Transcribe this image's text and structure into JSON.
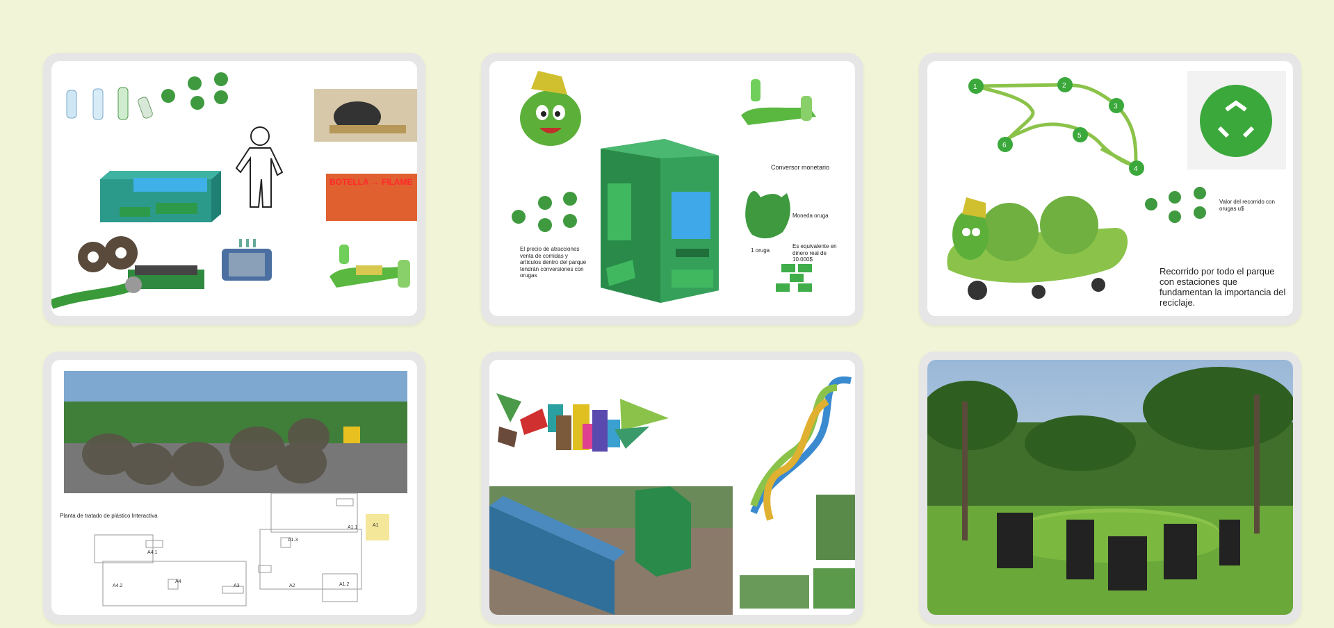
{
  "gallery": {
    "background": "#f2f4d8",
    "accent_green": "#3aa83a",
    "cards": [
      {
        "id": 1,
        "labels": {
          "bottle_banner": "BOTELLA → FILAME"
        }
      },
      {
        "id": 2,
        "labels": {
          "converter_title": "Conversor monetario",
          "coin_label": "Moneda oruga",
          "one_coin": "1 oruga",
          "equivalent": "Es equivalente en dinero real de 10.000$",
          "price_note": "El precio de atracciones venta de comidas y artículos dentro del parque tendrán conversiones con orugas"
        }
      },
      {
        "id": 3,
        "route_stops": [
          "1",
          "2",
          "3",
          "4",
          "5",
          "6"
        ],
        "labels": {
          "route_value": "Valor del recorrido con orugas u$",
          "route_desc": "Recorrido por todo el parque con estaciones que fundamentan la importancia del reciclaje."
        }
      },
      {
        "id": 4,
        "labels": {
          "plant_title": "Planta de tratado de plástico Interactiva",
          "zones": [
            "A1",
            "A1.1",
            "A1.2",
            "A1.3",
            "A2",
            "A3",
            "A4",
            "A4.1",
            "A4.2"
          ]
        }
      },
      {
        "id": 5
      },
      {
        "id": 6
      }
    ]
  }
}
